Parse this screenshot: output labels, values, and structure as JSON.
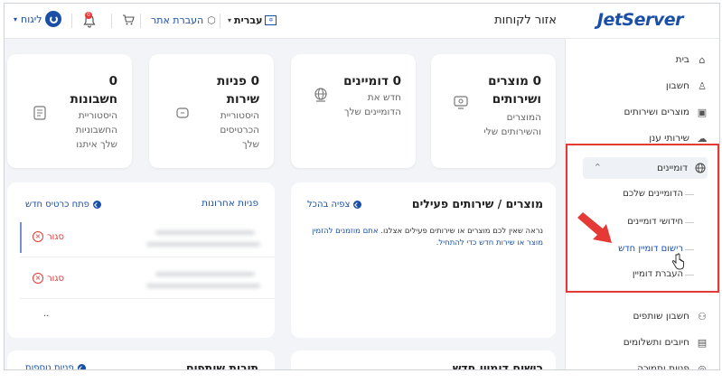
{
  "header": {
    "logo": "JetServer",
    "title": "אזור לקוחות",
    "logout": "ליגוח",
    "notifications_count": "0",
    "transfer": "העברת אתר",
    "language": "עברית"
  },
  "sidebar": {
    "items": [
      {
        "label": "בית",
        "icon": "home-icon"
      },
      {
        "label": "חשבון",
        "icon": "user-icon"
      },
      {
        "label": "מוצרים ושירותים",
        "icon": "box-icon"
      },
      {
        "label": "שירותי ענן",
        "icon": "cloud-icon"
      },
      {
        "label": "דומיינים",
        "icon": "globe-icon"
      },
      {
        "label": "חשבון שותפים",
        "icon": "users-icon"
      },
      {
        "label": "חיובים ותשלומים",
        "icon": "receipt-icon"
      },
      {
        "label": "פניות ותמיכה",
        "icon": "support-icon"
      }
    ],
    "domain_sub": [
      "הדומיינים שלכם",
      "חידושי דומיינים",
      "רישום דומיין חדש",
      "העברת דומיין"
    ]
  },
  "cards": [
    {
      "num": "0 מוצרים",
      "l1": "ושירותים",
      "desc": [
        "המוצרים",
        "והשירותים שלי"
      ]
    },
    {
      "num": "0 דומיינים",
      "l1": "",
      "desc": [
        "חדש את",
        "הדומיינים שלך"
      ]
    },
    {
      "num": "0 פניות",
      "l1": "שירות",
      "desc": [
        "היסטוריית",
        "הכרטיסים",
        "שלך"
      ]
    },
    {
      "num": "0",
      "l1": "חשבונות",
      "desc": [
        "היסטוריית",
        "החשבוניות",
        "שלך איתנו"
      ]
    }
  ],
  "panel_products": {
    "title": "מוצרים / שירותים פעילים",
    "link": "צפיה בהכל",
    "text_before": "נראה שאין לכם מוצרים או שירותים פעילים אצלנו. ",
    "text_link": "אתם מוזמנים להזמין מוצר או שירות חדש כדי להתחיל.",
    "text_after": ""
  },
  "panel_tickets": {
    "title": "פניות אחרונות",
    "link": "פתח כרטיס חדש",
    "rows": [
      {
        "status": "סגור"
      },
      {
        "status": "סגור"
      }
    ],
    "more": ".."
  },
  "bottom": {
    "left_title": "תיבות שותפים",
    "left_link": "פניות נוספות",
    "right_title": "רישום דומיין חדש"
  },
  "colors": {
    "accent": "#1a4fa8",
    "highlight_box": "#e53935",
    "closed": "#e53935"
  }
}
